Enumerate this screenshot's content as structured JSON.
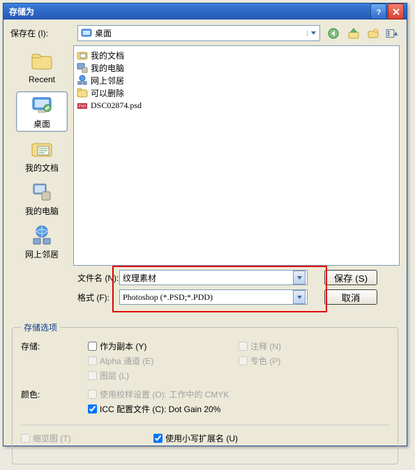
{
  "titlebar": {
    "title": "存储为"
  },
  "saveIn": {
    "label": "保存在 (I):",
    "value": "桌面"
  },
  "toolbar": {
    "back": "back-icon",
    "up": "up-icon",
    "newfolder": "newfolder-icon",
    "views": "views-icon"
  },
  "places": {
    "recent": "Recent",
    "desktop": "桌面",
    "mydocs": "我的文档",
    "mycomputer": "我的电脑",
    "network": "网上邻居"
  },
  "files": [
    {
      "icon": "folder-docs",
      "name": "我的文档"
    },
    {
      "icon": "computer",
      "name": "我的电脑"
    },
    {
      "icon": "network",
      "name": "网上邻居"
    },
    {
      "icon": "folder",
      "name": "可以删除"
    },
    {
      "icon": "psd",
      "name": "DSC02874.psd"
    }
  ],
  "form": {
    "filenameLabel": "文件名 (N):",
    "filenameValue": "纹理素材",
    "formatLabel": "格式 (F):",
    "formatValue": "Photoshop (*.PSD;*.PDD)",
    "saveBtn": "保存 (S)",
    "cancelBtn": "取消"
  },
  "options": {
    "legend": "存储选项",
    "saveLabel": "存储:",
    "asCopy": "作为副本 (Y)",
    "notes": "注释 (N)",
    "alpha": "Alpha 通道 (E)",
    "spot": "专色 (P)",
    "layers": "图层 (L)",
    "colorLabel": "颜色:",
    "proof": "使用校样设置 (O): 工作中的 CMYK",
    "icc": "ICC 配置文件 (C): Dot Gain 20%",
    "thumb": "缩览图 (T)",
    "lowerExt": "使用小写扩展名 (U)"
  }
}
